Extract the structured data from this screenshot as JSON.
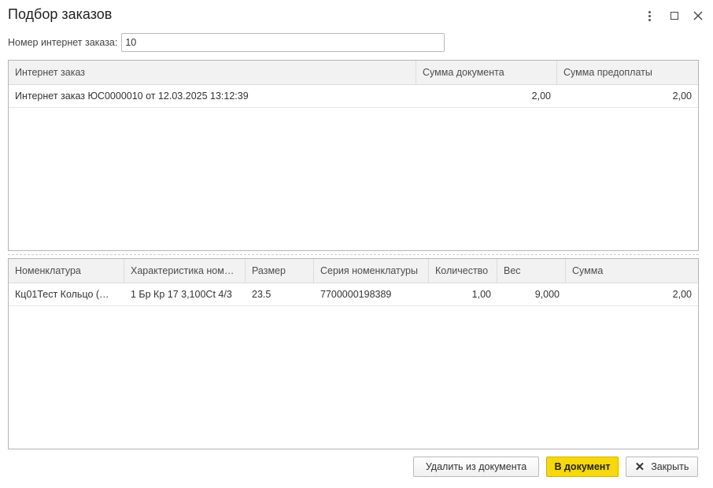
{
  "window": {
    "title": "Подбор заказов"
  },
  "filter": {
    "label": "Номер интернет заказа:",
    "value": "10"
  },
  "orders_table": {
    "columns": [
      "Интернет заказ",
      "Сумма документа",
      "Сумма предоплаты"
    ],
    "rows": [
      [
        "Интернет заказ ЮС0000010 от 12.03.2025 13:12:39",
        "2,00",
        "2,00"
      ]
    ]
  },
  "items_table": {
    "columns": [
      "Номенклатура",
      "Характеристика ном…",
      "Размер",
      "Серия номенклатуры",
      "Количество",
      "Вес",
      "Сумма"
    ],
    "rows": [
      [
        "Кц01Тест Кольцо (…",
        "1 Бр Кр 17 3,100Ct 4/3",
        "23.5",
        "7700000198389",
        "1,00",
        "9,000",
        "2,00"
      ]
    ]
  },
  "buttons": {
    "remove_label": "Удалить из документа",
    "add_label": "В документ",
    "close_label": "Закрыть"
  },
  "icons": {
    "more": "more-vertical-icon",
    "maximize": "maximize-icon",
    "close": "close-icon"
  },
  "colors": {
    "accent_button": "#f6d80e"
  }
}
